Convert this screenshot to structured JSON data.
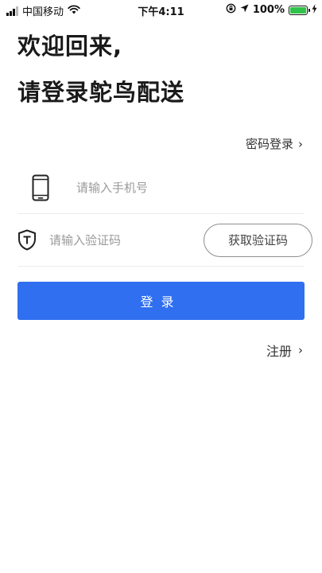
{
  "status_bar": {
    "carrier": "中国移动",
    "time": "下午4:11",
    "battery_percent": "100%",
    "battery_level": 1.0,
    "battery_color": "#2fc34a"
  },
  "header": {
    "line1": "欢迎回来,",
    "line2": "请登录鸵鸟配送"
  },
  "password_login": {
    "label": "密码登录",
    "chevron": "›"
  },
  "phone_field": {
    "placeholder": "请输入手机号",
    "value": "",
    "icon": "phone-icon"
  },
  "code_field": {
    "placeholder": "请输入验证码",
    "value": "",
    "icon": "shield-icon",
    "get_code_label": "获取验证码"
  },
  "login_button": {
    "label": "登录",
    "color": "#2f6ff0"
  },
  "register": {
    "label": "注册",
    "chevron": "›"
  }
}
